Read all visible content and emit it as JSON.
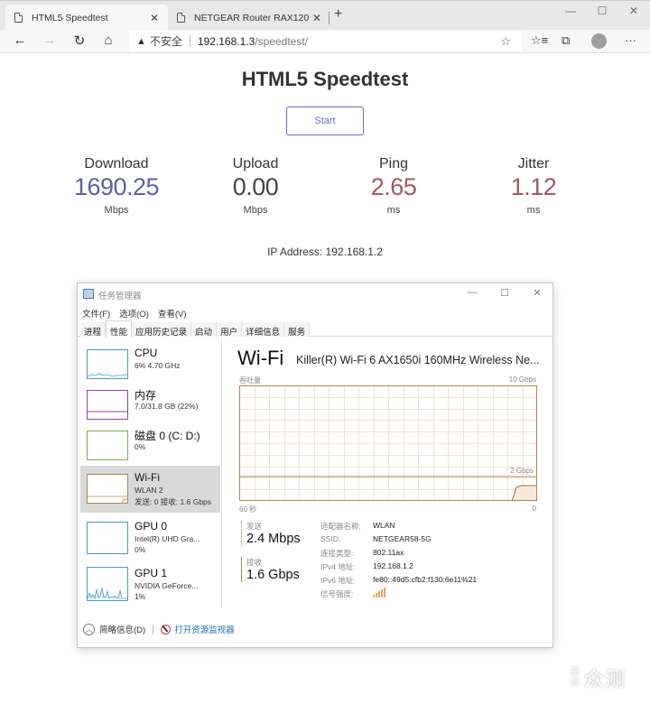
{
  "browser": {
    "tabs": [
      {
        "title": "HTML5 Speedtest",
        "active": true
      },
      {
        "title": "NETGEAR Router RAX120",
        "active": false
      }
    ],
    "new_tab_icon": "+",
    "window_controls": {
      "minimize": "—",
      "maximize": "☐",
      "close": "✕"
    },
    "nav": {
      "back": "←",
      "forward": "→",
      "reload": "↻",
      "home": "⌂"
    },
    "address": {
      "security_icon": "▲",
      "security_text": "不安全",
      "host": "192.168.1.3",
      "path": "/speedtest/"
    },
    "toolbar_icons": {
      "favorite": "☆",
      "favorites_list": "☆≡",
      "collections": "⧉",
      "more": "···"
    }
  },
  "speedtest": {
    "title": "HTML5 Speedtest",
    "start_label": "Start",
    "metrics": [
      {
        "label": "Download",
        "value": "1690.25",
        "unit": "Mbps",
        "color": "#6060a0"
      },
      {
        "label": "Upload",
        "value": "0.00",
        "unit": "Mbps",
        "color": "#444444"
      },
      {
        "label": "Ping",
        "value": "2.65",
        "unit": "ms",
        "color": "#a05a60"
      },
      {
        "label": "Jitter",
        "value": "1.12",
        "unit": "ms",
        "color": "#a05a60"
      }
    ],
    "ip_address": "IP Address: 192.168.1.2"
  },
  "taskmgr": {
    "title": "任务管理器",
    "window_controls": {
      "minimize": "—",
      "maximize": "☐",
      "close": "✕"
    },
    "menu": [
      "文件(F)",
      "选项(O)",
      "查看(V)"
    ],
    "tabs": [
      {
        "label": "进程",
        "active": false
      },
      {
        "label": "性能",
        "active": true
      },
      {
        "label": "应用历史记录",
        "active": false
      },
      {
        "label": "启动",
        "active": false
      },
      {
        "label": "用户",
        "active": false
      },
      {
        "label": "详细信息",
        "active": false
      },
      {
        "label": "服务",
        "active": false
      }
    ],
    "sidebar": [
      {
        "name": "CPU",
        "lines": [
          "6% 4.70 GHz"
        ],
        "color": "#4a9bbf"
      },
      {
        "name": "内存",
        "lines": [
          "7.0/31.8 GB (22%)"
        ],
        "color": "#9b3fa8"
      },
      {
        "name": "磁盘 0 (C: D:)",
        "lines": [
          "0%"
        ],
        "color": "#7ab04a"
      },
      {
        "name": "Wi-Fi",
        "lines": [
          "WLAN 2",
          "发送: 0 接收: 1.6 Gbps"
        ],
        "color": "#b5834d",
        "selected": true
      },
      {
        "name": "GPU 0",
        "lines": [
          "Intel(R) UHD Gra...",
          "0%"
        ],
        "color": "#4a9bbf"
      },
      {
        "name": "GPU 1",
        "lines": [
          "NVIDIA GeForce...",
          "1%"
        ],
        "color": "#4a9bbf"
      }
    ],
    "detail": {
      "title": "Wi-Fi",
      "adapter": "Killer(R) Wi-Fi 6 AX1650i 160MHz Wireless Ne...",
      "throughput_label": "吞吐量",
      "max_label": "10 Gbps",
      "scale_label": "2 Gbps",
      "time_left": "60 秒",
      "time_right": "0",
      "graph_color": "#b5834d",
      "send": {
        "label": "发送",
        "value": "2.4 Mbps"
      },
      "receive": {
        "label": "接收",
        "value": "1.6 Gbps"
      },
      "properties": [
        {
          "key": "适配器名称:",
          "value": "WLAN"
        },
        {
          "key": "SSID:",
          "value": "NETGEAR58-5G"
        },
        {
          "key": "连接类型:",
          "value": "802.11ax"
        },
        {
          "key": "IPv4 地址:",
          "value": "192.168.1.2"
        },
        {
          "key": "IPv6 地址:",
          "value": "fe80::49d5:cfb2:f130:6e11%21"
        },
        {
          "key": "信号强度:",
          "value": ""
        }
      ],
      "signal_bars": 5
    },
    "footer": {
      "fewer_details": "简略信息(D)",
      "open_resmon": "打开资源监视器"
    }
  },
  "watermark": {
    "small": "新浪",
    "big": "众测"
  }
}
